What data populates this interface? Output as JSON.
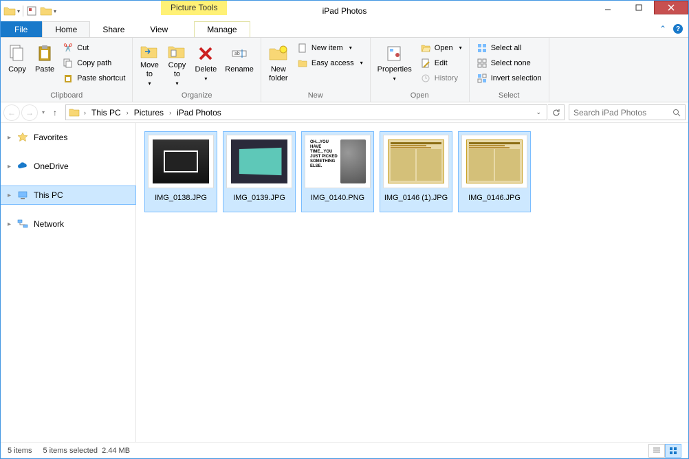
{
  "window": {
    "title": "iPad Photos",
    "tool_tab": "Picture Tools"
  },
  "tabs": {
    "file": "File",
    "home": "Home",
    "share": "Share",
    "view": "View",
    "manage": "Manage"
  },
  "ribbon": {
    "clipboard": {
      "copy": "Copy",
      "paste": "Paste",
      "cut": "Cut",
      "copy_path": "Copy path",
      "paste_shortcut": "Paste shortcut",
      "label": "Clipboard"
    },
    "organize": {
      "move_to": "Move\nto",
      "copy_to": "Copy\nto",
      "delete": "Delete",
      "rename": "Rename",
      "label": "Organize"
    },
    "new": {
      "new_folder": "New\nfolder",
      "new_item": "New item",
      "easy_access": "Easy access",
      "label": "New"
    },
    "open": {
      "properties": "Properties",
      "open": "Open",
      "edit": "Edit",
      "history": "History",
      "label": "Open"
    },
    "select": {
      "select_all": "Select all",
      "select_none": "Select none",
      "invert": "Invert selection",
      "label": "Select"
    }
  },
  "path": {
    "root": "This PC",
    "p1": "Pictures",
    "p2": "iPad Photos"
  },
  "search": {
    "placeholder": "Search iPad Photos"
  },
  "sidebar": {
    "favorites": "Favorites",
    "onedrive": "OneDrive",
    "this_pc": "This PC",
    "network": "Network"
  },
  "files": [
    {
      "name": "IMG_0138.JPG"
    },
    {
      "name": "IMG_0139.JPG"
    },
    {
      "name": "IMG_0140.PNG"
    },
    {
      "name": "IMG_0146 (1).JPG"
    },
    {
      "name": "IMG_0146.JPG"
    }
  ],
  "status": {
    "count": "5 items",
    "selection": "5 items selected",
    "size": "2.44 MB"
  }
}
